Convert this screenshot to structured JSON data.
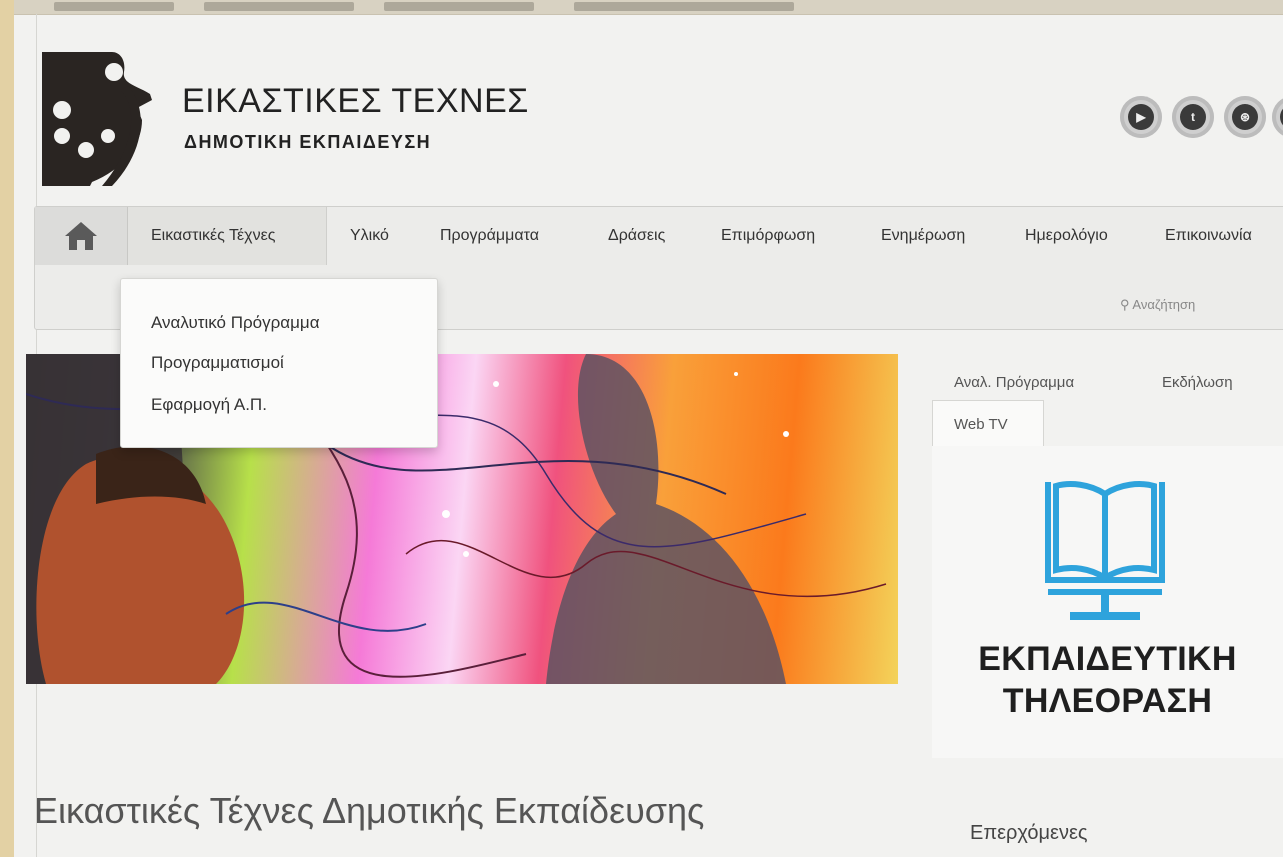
{
  "header": {
    "title": "ΕΙΚΑΣΤΙΚΕΣ ΤΕΧΝΕΣ",
    "subtitle": "ΔΗΜΟΤΙΚΗ ΕΚΠΑΙΔΕΥΣΗ",
    "social_icons": [
      "youtube-icon",
      "twitter-icon",
      "dribbble-icon"
    ]
  },
  "nav": {
    "home_icon": "home-icon",
    "items": [
      "Εικαστικές Τέχνες",
      "Υλικό",
      "Προγράμματα",
      "Δράσεις",
      "Επιμόρφωση",
      "Ενημέρωση",
      "Ημερολόγιο",
      "Επικοινωνία"
    ],
    "search_placeholder": "Αναζήτηση"
  },
  "dropdown": {
    "items": [
      "Αναλυτικό Πρόγραμμα",
      "Προγραμματισμοί",
      "Εφαρμογή Α.Π."
    ]
  },
  "sidebar": {
    "tabs": [
      "Αναλ. Πρόγραμμα",
      "Εκδήλωση",
      "Web TV"
    ],
    "active_tab": "Web TV",
    "tv_title_line1": "ΕΚΠΑΙΔΕΥΤΙΚΗ",
    "tv_title_line2": "ΤΗΛΕΟΡΑΣΗ",
    "upcoming_label": "Επερχόμενες"
  },
  "main": {
    "heading": "Εικαστικές Τέχνες Δημοτικής Εκπαίδευσης"
  },
  "colors": {
    "tv_icon": "#2ea3dc",
    "logo_dark": "#2a2522"
  }
}
